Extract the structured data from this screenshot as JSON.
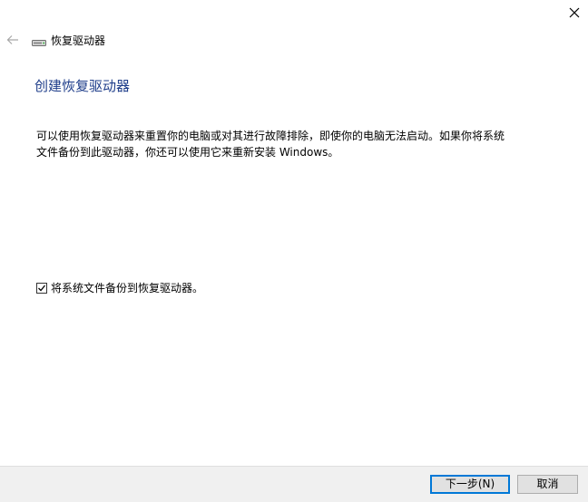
{
  "window": {
    "title": "恢复驱动器",
    "close_icon": "close-icon",
    "back_icon": "back-arrow-icon",
    "drive_icon": "drive-icon"
  },
  "content": {
    "heading": "创建恢复驱动器",
    "description": "可以使用恢复驱动器来重置你的电脑或对其进行故障排除，即使你的电脑无法启动。如果你将系统文件备份到此驱动器，你还可以使用它来重新安装 Windows。",
    "backup_checkbox": {
      "label": "将系统文件备份到恢复驱动器。",
      "checked": true
    }
  },
  "footer": {
    "next_label": "下一步(N)",
    "cancel_label": "取消"
  },
  "colors": {
    "heading": "#1e3d8a",
    "footer_bg": "#f0f0f0",
    "default_button_border": "#0078d7"
  }
}
